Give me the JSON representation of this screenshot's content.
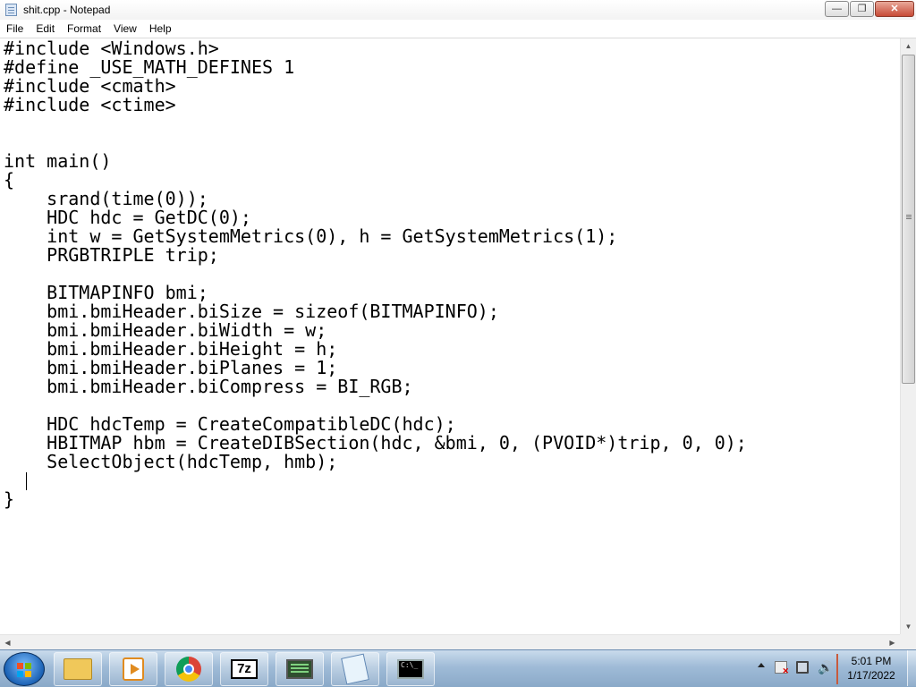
{
  "window": {
    "title": "shit.cpp - Notepad",
    "minimize_icon": "minimize-icon",
    "maximize_icon": "restore-icon",
    "close_icon": "close-icon"
  },
  "menu": {
    "items": [
      "File",
      "Edit",
      "Format",
      "View",
      "Help"
    ]
  },
  "editor": {
    "lines": [
      "#include <Windows.h>",
      "#define _USE_MATH_DEFINES 1",
      "#include <cmath>",
      "#include <ctime>",
      "",
      "",
      "int main()",
      "{",
      "    srand(time(0));",
      "    HDC hdc = GetDC(0);",
      "    int w = GetSystemMetrics(0), h = GetSystemMetrics(1);",
      "    PRGBTRIPLE trip;",
      "",
      "    BITMAPINFO bmi;",
      "    bmi.bmiHeader.biSize = sizeof(BITMAPINFO);",
      "    bmi.bmiHeader.biWidth = w;",
      "    bmi.bmiHeader.biHeight = h;",
      "    bmi.bmiHeader.biPlanes = 1;",
      "    bmi.bmiHeader.biCompress = BI_RGB;",
      "",
      "    HDC hdcTemp = CreateCompatibleDC(hdc);",
      "    HBITMAP hbm = CreateDIBSection(hdc, &bmi, 0, (PVOID*)trip, 0, 0);",
      "    SelectObject(hdcTemp, hmb);",
      "",
      "}"
    ]
  },
  "taskbar": {
    "start_icon": "windows-start-icon",
    "apps": [
      {
        "name": "file-explorer",
        "icon": "folder-icon"
      },
      {
        "name": "media-player",
        "icon": "media-player-icon"
      },
      {
        "name": "google-chrome",
        "icon": "chrome-icon"
      },
      {
        "name": "7-zip",
        "icon": "sevenzip-icon",
        "label": "7z"
      },
      {
        "name": "task-monitor",
        "icon": "monitor-icon"
      },
      {
        "name": "notepad",
        "icon": "notepad-icon"
      },
      {
        "name": "command-prompt",
        "icon": "console-icon",
        "label": "C:\\_"
      }
    ],
    "clock": {
      "time": "5:01 PM",
      "date": "1/17/2022"
    }
  }
}
